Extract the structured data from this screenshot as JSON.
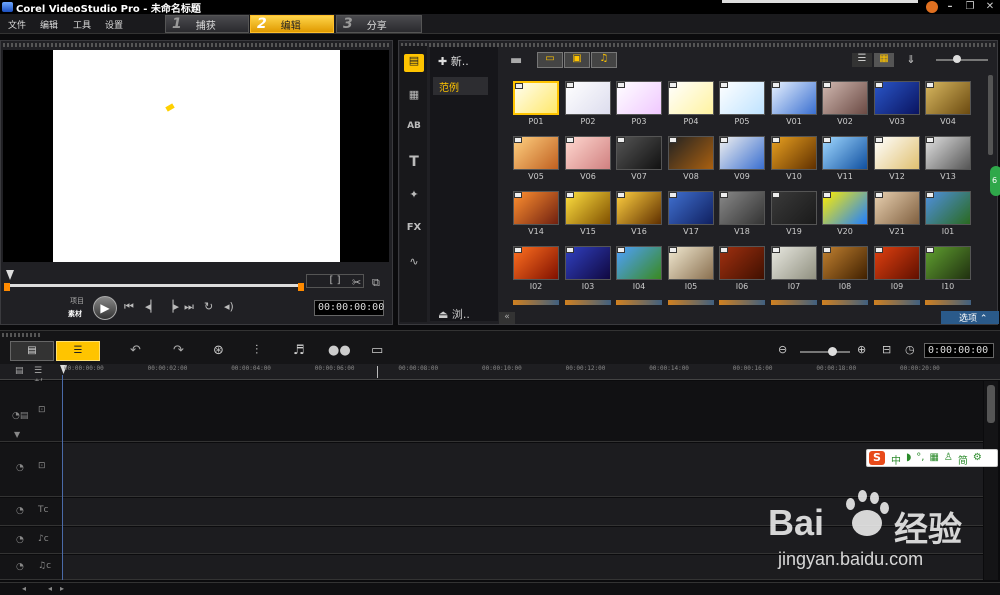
{
  "window": {
    "title": "Corel VideoStudio Pro - 未命名标题",
    "min": "–",
    "restore": "❐",
    "close": "✕"
  },
  "menu": [
    "文件",
    "编辑",
    "工具",
    "设置"
  ],
  "steps": [
    {
      "num": "1",
      "label": "捕获"
    },
    {
      "num": "2",
      "label": "编辑"
    },
    {
      "num": "3",
      "label": "分享"
    }
  ],
  "preview": {
    "project_label": "项目",
    "clip_label": "素材",
    "timecode_main": "00:00:00:00",
    "trim_glyph": "[ ]"
  },
  "library": {
    "new_folder": "新..",
    "category": "范例",
    "browse": "浏..",
    "options": "选项",
    "thumbs": [
      {
        "id": "P01",
        "c1": "#fffef0",
        "c2": "#ffe86a"
      },
      {
        "id": "P02",
        "c1": "#ffffff",
        "c2": "#dde"
      },
      {
        "id": "P03",
        "c1": "#ffffff",
        "c2": "#f0c8ff"
      },
      {
        "id": "P04",
        "c1": "#ffffff",
        "c2": "#fff3a0"
      },
      {
        "id": "P05",
        "c1": "#ffffff",
        "c2": "#bfe3ff"
      },
      {
        "id": "V01",
        "c1": "#e8f2ff",
        "c2": "#3a6fd0"
      },
      {
        "id": "V02",
        "c1": "#d0b8b0",
        "c2": "#6b4a44"
      },
      {
        "id": "V03",
        "c1": "#2a56c8",
        "c2": "#0a1460"
      },
      {
        "id": "V04",
        "c1": "#d8b860",
        "c2": "#6b4a10"
      },
      {
        "id": "V05",
        "c1": "#ffd080",
        "c2": "#c06020"
      },
      {
        "id": "V06",
        "c1": "#ffd8d0",
        "c2": "#d08080"
      },
      {
        "id": "V07",
        "c1": "#555",
        "c2": "#111"
      },
      {
        "id": "V08",
        "c1": "#222",
        "c2": "#aa6010"
      },
      {
        "id": "V09",
        "c1": "#f0f0f0",
        "c2": "#3a6fd0"
      },
      {
        "id": "V10",
        "c1": "#e8a020",
        "c2": "#603000"
      },
      {
        "id": "V11",
        "c1": "#a0d8ff",
        "c2": "#1050a0"
      },
      {
        "id": "V12",
        "c1": "#ffffff",
        "c2": "#e0c070"
      },
      {
        "id": "V13",
        "c1": "#e0e0e0",
        "c2": "#555"
      },
      {
        "id": "V14",
        "c1": "#ff9030",
        "c2": "#702010"
      },
      {
        "id": "V15",
        "c1": "#ffe040",
        "c2": "#805000"
      },
      {
        "id": "V16",
        "c1": "#ffd040",
        "c2": "#603000"
      },
      {
        "id": "V17",
        "c1": "#4070d0",
        "c2": "#102060"
      },
      {
        "id": "V18",
        "c1": "#888",
        "c2": "#333"
      },
      {
        "id": "V19",
        "c1": "#3a3a3a",
        "c2": "#1a1a1a"
      },
      {
        "id": "V20",
        "c1": "#ffee00",
        "c2": "#2080ff"
      },
      {
        "id": "V21",
        "c1": "#e8d0b0",
        "c2": "#806040"
      },
      {
        "id": "I01",
        "c1": "#5090e0",
        "c2": "#2a6a20"
      },
      {
        "id": "I02",
        "c1": "#ff7020",
        "c2": "#801000"
      },
      {
        "id": "I03",
        "c1": "#3040c0",
        "c2": "#100840"
      },
      {
        "id": "I04",
        "c1": "#4fa0ff",
        "c2": "#3a8a20"
      },
      {
        "id": "I05",
        "c1": "#f0e8d0",
        "c2": "#8a7050"
      },
      {
        "id": "I06",
        "c1": "#a03010",
        "c2": "#401000"
      },
      {
        "id": "I07",
        "c1": "#e8e8e0",
        "c2": "#909080"
      },
      {
        "id": "I08",
        "c1": "#c08030",
        "c2": "#402000"
      },
      {
        "id": "I09",
        "c1": "#e04010",
        "c2": "#601000"
      },
      {
        "id": "I10",
        "c1": "#60a030",
        "c2": "#203010"
      }
    ]
  },
  "timeline": {
    "timecode": "0:00:00:00",
    "ruler": [
      "00:00:00:00",
      "00:00:02:00",
      "00:00:04:00",
      "00:00:06:00",
      "00:00:08:00",
      "00:00:10:00",
      "00:00:12:00",
      "00:00:14:00",
      "00:00:16:00",
      "00:00:18:00",
      "00:00:20:00"
    ]
  },
  "ime": {
    "items": [
      "中",
      "◗",
      "°,",
      "▦",
      "♙",
      "简",
      "⚙"
    ]
  },
  "watermark": {
    "brand": "Bai",
    "brand2": "经验",
    "url": "jingyan.baidu.com"
  }
}
